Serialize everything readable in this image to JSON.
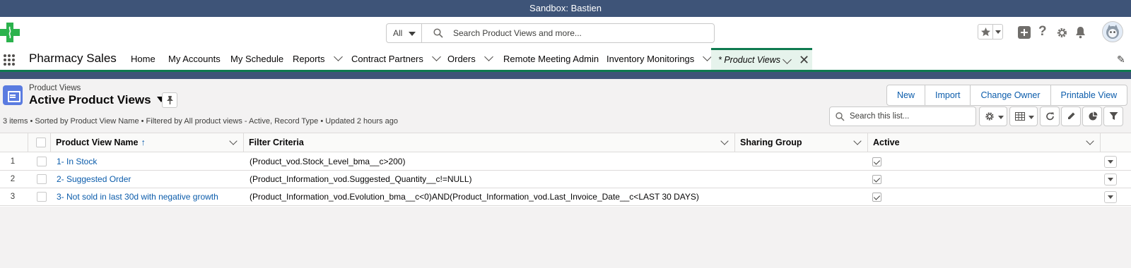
{
  "sandbox_label": "Sandbox: Bastien",
  "global_header": {
    "search_scope": "All",
    "search_placeholder": "Search Product Views and more..."
  },
  "app": {
    "name": "Pharmacy Sales",
    "nav_items": [
      {
        "label": "Home",
        "has_menu": false
      },
      {
        "label": "My Accounts",
        "has_menu": false
      },
      {
        "label": "My Schedule",
        "has_menu": false
      },
      {
        "label": "Reports",
        "has_menu": true
      },
      {
        "label": "Contract Partners",
        "has_menu": true
      },
      {
        "label": "Orders",
        "has_menu": true
      },
      {
        "label": "Remote Meeting Admin",
        "has_menu": false
      },
      {
        "label": "Inventory Monitorings",
        "has_menu": true
      }
    ],
    "active_tab": "* Product Views"
  },
  "list_view": {
    "object_label": "Product Views",
    "title": "Active Product Views",
    "actions": [
      "New",
      "Import",
      "Change Owner",
      "Printable View"
    ],
    "meta": "3 items • Sorted by Product View Name • Filtered by All product views - Active, Record Type • Updated 2 hours ago",
    "search_placeholder": "Search this list...",
    "columns": [
      {
        "label": "Product View Name",
        "sorted": "↑"
      },
      {
        "label": "Filter Criteria"
      },
      {
        "label": "Sharing Group"
      },
      {
        "label": "Active"
      }
    ],
    "rows": [
      {
        "num": "1",
        "name": "1- In Stock",
        "criteria": "(Product_vod.Stock_Level_bma__c>200)",
        "sharing_group": "",
        "active": true
      },
      {
        "num": "2",
        "name": "2- Suggested Order",
        "criteria": "(Product_Information_vod.Suggested_Quantity__c!=NULL)",
        "sharing_group": "",
        "active": true
      },
      {
        "num": "3",
        "name": "3- Not sold in last 30d with negative growth",
        "criteria": "(Product_Information_vod.Evolution_bma__c<0)AND(Product_Information_vod.Last_Invoice_Date__c<LAST 30 DAYS)",
        "sharing_group": "",
        "active": true
      }
    ]
  },
  "colors": {
    "sandbox_bar": "#3e5478",
    "nav_accent": "#0e7a4f",
    "active_tab_bg": "#e6f3ec",
    "link": "#0b5cab",
    "object_icon": "#5a7be0"
  },
  "icons": [
    "medical-cross-logo",
    "search-icon",
    "favorites-star-icon",
    "add-icon",
    "help-icon",
    "setup-gear-icon",
    "notifications-bell-icon",
    "avatar",
    "app-launcher-waffle-icon",
    "edit-nav-pencil-icon",
    "product-views-object-icon",
    "pin-icon",
    "list-settings-gear-icon",
    "display-as-table-icon",
    "refresh-icon",
    "inline-edit-pencil-icon",
    "charts-icon",
    "filter-icon"
  ]
}
